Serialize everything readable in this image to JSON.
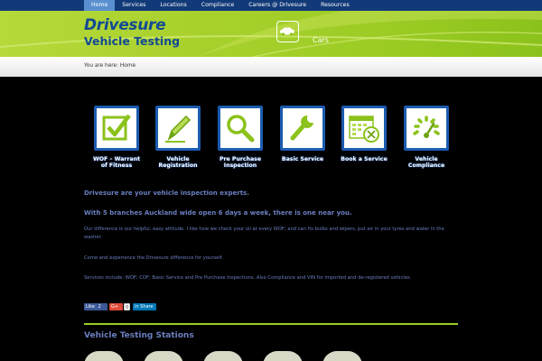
{
  "nav": {
    "items": [
      {
        "label": "Home",
        "active": true
      },
      {
        "label": "Services"
      },
      {
        "label": "Locations"
      },
      {
        "label": "Compliance"
      },
      {
        "label": "Careers @ Drivesure"
      },
      {
        "label": "Resources"
      }
    ]
  },
  "header": {
    "logo_title": "Drivesure",
    "logo_subtitle": "Vehicle Testing",
    "section_label": "Cars",
    "section_icon": "car-icon"
  },
  "breadcrumb": {
    "text": "You are here: Home"
  },
  "services": [
    {
      "label": "WOF – Warrant of Fitness",
      "line1": "WOF – Warrant",
      "line2": "of Fitness",
      "icon": "checkmark-icon"
    },
    {
      "label": "Vehicle Registration",
      "line1": "Vehicle",
      "line2": "Registration",
      "icon": "pencil-icon"
    },
    {
      "label": "Pre Purchase Inspection",
      "line1": "Pre Purchase",
      "line2": "Inspection",
      "icon": "magnifier-icon"
    },
    {
      "label": "Basic Service",
      "line1": "Basic Service",
      "line2": "",
      "icon": "wrench-icon"
    },
    {
      "label": "Book a Service",
      "line1": "Book a Service",
      "line2": "",
      "icon": "calendar-icon"
    },
    {
      "label": "Vehicle Compliance",
      "line1": "Vehicle",
      "line2": "Compliance",
      "icon": "gauge-icon"
    }
  ],
  "content": {
    "lead1": "Drivesure are your vehicle inspection experts.",
    "lead2": "With 5 branches Auckland wide open 6 days a week, there is one near you.",
    "p1": "Our difference is our helpful, easy attitude. I like how we check your oil at every WOF; and can fix bulbs and wipers, put air in your tyres and water in the washer.",
    "p2": "Come and experience the Drivesure difference for yourself.",
    "p3": "Services include: WOF; COF; Basic Service and Pre Purchase Inspections. Also Compliance and VIN for imported and de-registered vehicles."
  },
  "share": {
    "like_label": "Like",
    "like_count": "2",
    "gplus_label": "G+",
    "gplus_count": "0",
    "linkedin_label": "in Share"
  },
  "stations": {
    "title": "Vehicle Testing Stations"
  },
  "colors": {
    "nav_bg": "#123a78",
    "accent_green": "#9ccc25",
    "brand_blue": "#134a93",
    "text_blue": "#6a7fc0"
  }
}
